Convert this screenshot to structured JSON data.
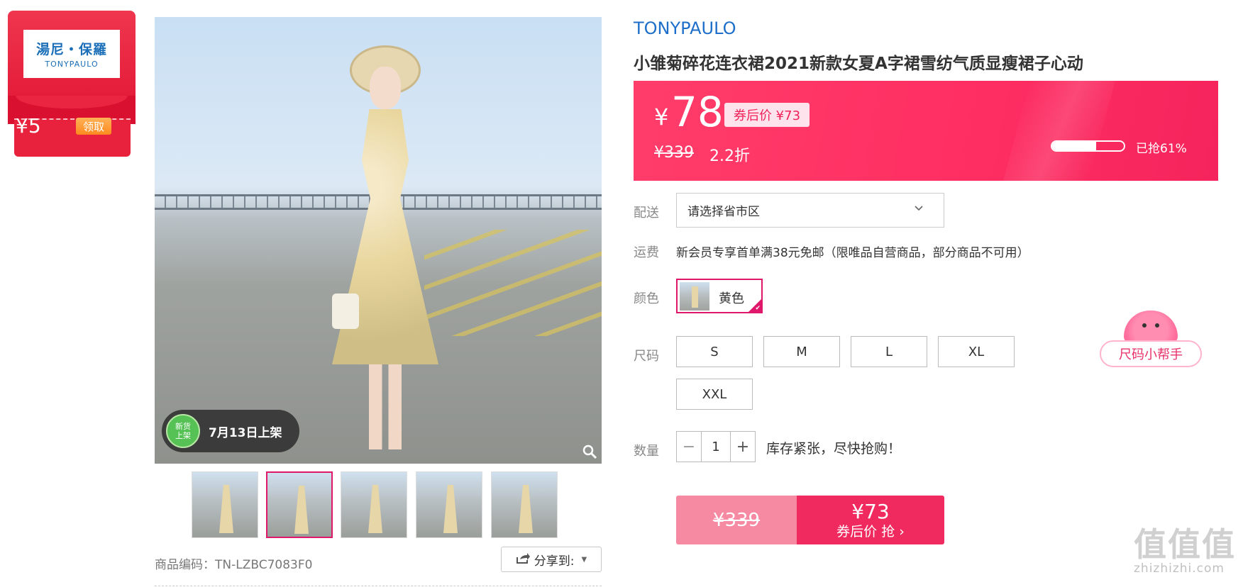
{
  "coupon": {
    "brand_cn": "湯尼・保羅",
    "brand_en": "TONYPAULO",
    "amount": "¥5",
    "claim_label": "领取"
  },
  "gallery": {
    "new_badge": "新货\n上架",
    "new_date": "7月13日上架",
    "zoom_icon": "magnifier-icon",
    "thumbnails": [
      {
        "active": false
      },
      {
        "active": true
      },
      {
        "active": false
      },
      {
        "active": false
      },
      {
        "active": false
      }
    ],
    "sku_code": "商品编码：TN-LZBC7083F0",
    "share_label": "分享到:"
  },
  "product": {
    "brand": "TONYPAULO",
    "title": "小雏菊碎花连衣裙2021新款女夏A字裙雪纺气质显瘦裙子心动"
  },
  "price": {
    "currency": "¥",
    "current": "78",
    "after_coupon": "券后价 ¥73",
    "original": "¥339",
    "discount": "2.2折",
    "sold_ratio": 0.61,
    "sold_label": "已抢61%"
  },
  "options": {
    "delivery_label": "配送",
    "region_placeholder": "请选择省市区",
    "shipping_label": "运费",
    "shipping_text": "新会员专享首单满38元免邮（限唯品自营商品，部分商品不可用）",
    "color_label": "颜色",
    "color_value": "黄色",
    "size_label": "尺码",
    "sizes": [
      "S",
      "M",
      "L",
      "XL",
      "XXL"
    ],
    "size_helper": "尺码小帮手",
    "qty_label": "数量",
    "qty_value": "1",
    "qty_minus": "−",
    "qty_plus": "+",
    "stock_text": "库存紧张，尽快抢购！"
  },
  "buy": {
    "original": "¥339",
    "price": "¥73",
    "label": "券后价 抢 ›"
  },
  "watermark": {
    "glyphs": "值值值",
    "site": "zhizhizhi.com"
  },
  "colors": {
    "accent": "#f0295e",
    "brand_blue": "#1e6fc9",
    "coupon_red": "#e8213c"
  }
}
